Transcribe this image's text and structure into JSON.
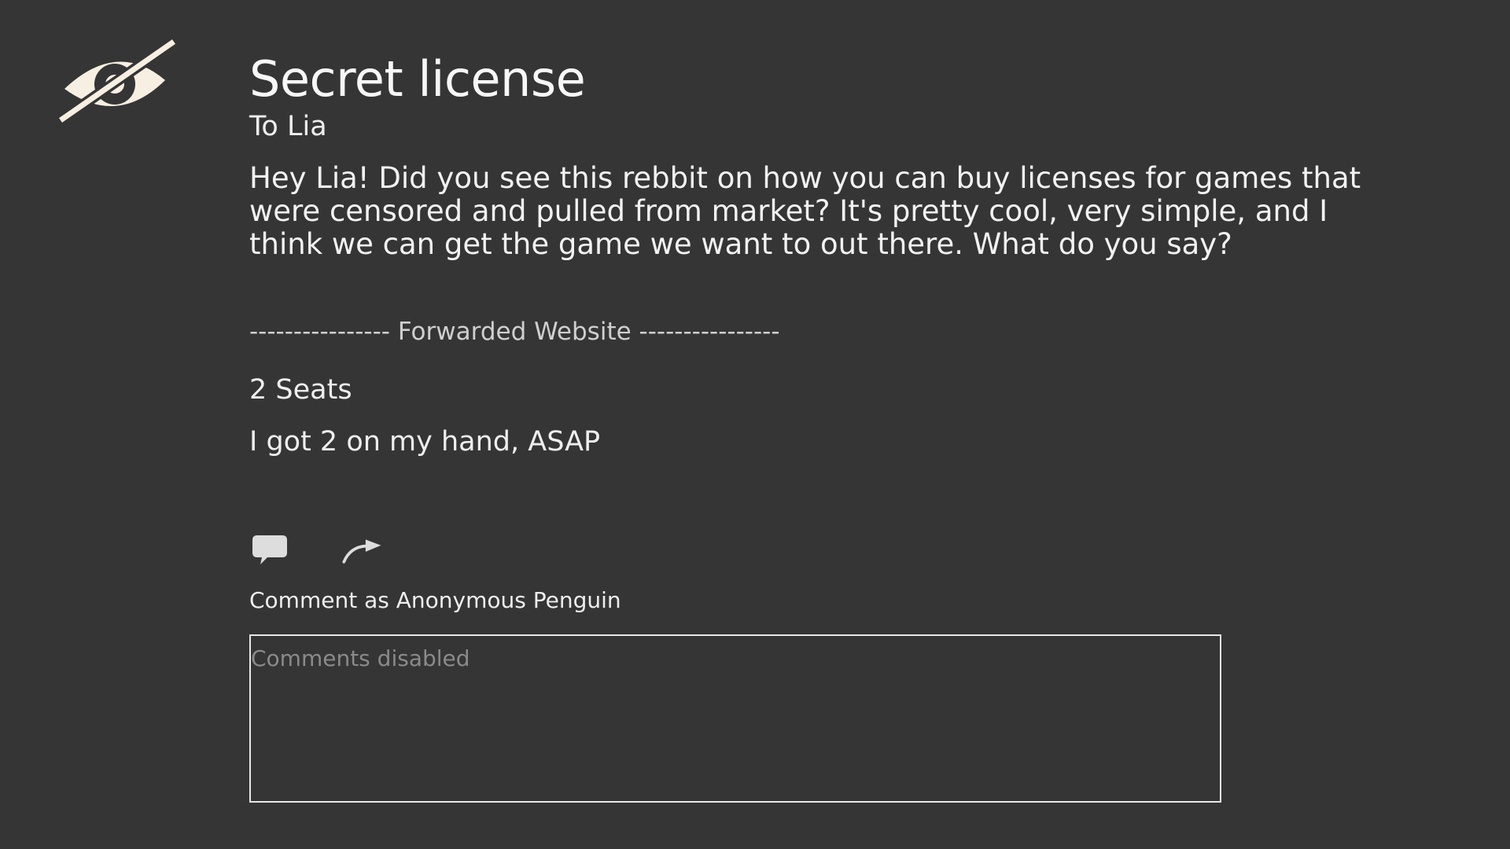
{
  "post": {
    "title": "Secret license",
    "recipient": "To Lia",
    "message": "Hey Lia! Did you see this rebbit on how you can buy licenses for games that were censored and pulled from market? It's pretty cool, very simple, and I think we can get the game we want to out there. What do you say?"
  },
  "forwarded": {
    "separator": "---------------- Forwarded Website ----------------",
    "title": "2 Seats",
    "body": "I got 2 on my hand, ASAP"
  },
  "actions": {
    "comment_icon": "speech-bubble-icon",
    "share_icon": "forward-arrow-icon"
  },
  "comment": {
    "label": "Comment as Anonymous Penguin",
    "placeholder": "Comments disabled",
    "value": ""
  },
  "colors": {
    "background": "#353535",
    "logo": "#f7efe1",
    "icon": "#dddddd",
    "text": "#f2f2f2"
  }
}
